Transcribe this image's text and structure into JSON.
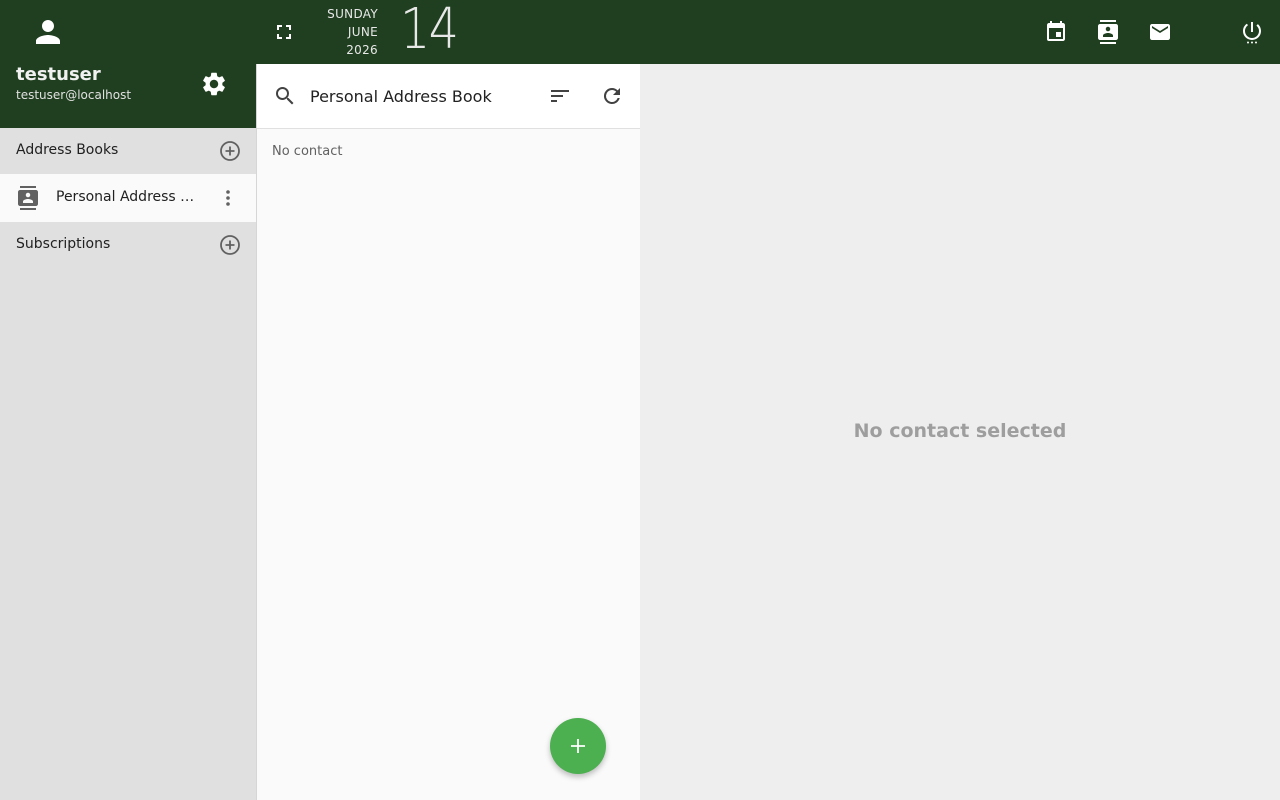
{
  "user": {
    "name": "testuser",
    "email": "testuser@localhost"
  },
  "date": {
    "weekday": "SUNDAY",
    "month": "JUNE",
    "year": "2026",
    "day": "14"
  },
  "sidebar": {
    "address_books_label": "Address Books",
    "books": [
      {
        "label": "Personal Address Book"
      }
    ],
    "subscriptions_label": "Subscriptions"
  },
  "list": {
    "title": "Personal Address Book",
    "empty_text": "No contact"
  },
  "detail": {
    "empty_text": "No contact selected"
  },
  "colors": {
    "header_bg": "#203f20",
    "fab": "#4caf50",
    "sidebar_bg": "#e0e0e0"
  },
  "icons": {
    "avatar": "account-icon",
    "settings": "gear-icon",
    "fullscreen": "fullscreen-icon",
    "calendar": "calendar-icon",
    "contacts": "contacts-icon",
    "mail": "mail-icon",
    "power": "power-icon",
    "search": "search-icon",
    "sort": "sort-icon",
    "refresh": "refresh-icon",
    "add": "plus-icon"
  }
}
